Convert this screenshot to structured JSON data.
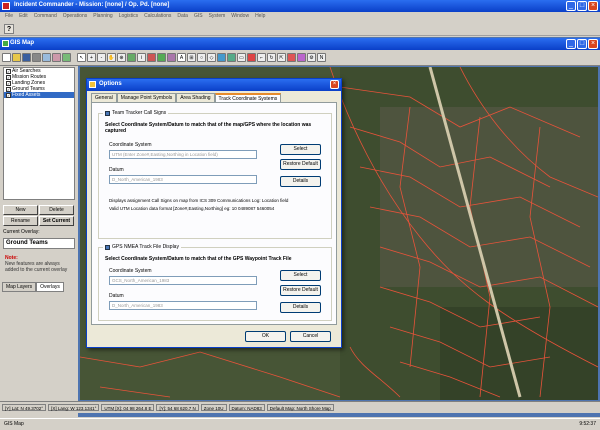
{
  "app": {
    "title": "Incident Commander - Mission: [none] / Op. Pd. [none]"
  },
  "menu": [
    "File",
    "Edit",
    "Command",
    "Operations",
    "Planning",
    "Logistics",
    "Calculations",
    "Data",
    "GIS",
    "System",
    "Window",
    "Help"
  ],
  "gis": {
    "title": "GIS Map"
  },
  "layers": [
    {
      "label": "Air Searches",
      "sel": false
    },
    {
      "label": "Mission Routes",
      "sel": false
    },
    {
      "label": "Landing Zones",
      "sel": false
    },
    {
      "label": "Ground Teams",
      "sel": false
    },
    {
      "label": "Fixed Assets",
      "sel": true
    }
  ],
  "left": {
    "new": "New",
    "delete": "Delete",
    "rename": "Rename",
    "set_current": "Set Current",
    "current_overlay_label": "Current Overlay:",
    "current_overlay": "Ground Teams",
    "note_title": "Note:",
    "note_text": "New features are always added to the current overlay",
    "tab_map_layers": "Map Layers",
    "tab_overlays": "Overlays"
  },
  "dialog": {
    "title": "Options",
    "tabs": [
      "General",
      "Manage Point Symbols",
      "Area Shading",
      "Track Coordinate Systems"
    ],
    "g1": {
      "label": "Team Tracker Call Signs",
      "instr": "Select Coordinate System/Datum to match that of the map/GPS where the location was captured",
      "cs_label": "Coordinate System",
      "cs_value": "UTM (Enter Zone#,Easting,Northing in Location field)",
      "datum_label": "Datum",
      "datum_value": "D_North_American_1983",
      "select": "Select",
      "restore": "Restore Default",
      "details": "Details",
      "help1": "Displays assignment Call Signs on map from ICS 309 Communications Log: Location field",
      "help2": "Valid UTM Location data format [Zone#,Easting,Northing] eg: 10 0489087 5460054"
    },
    "g2": {
      "label": "GPS NMEA Track File Display",
      "instr": "Select Coordinate System/Datum to match that of the GPS Waypoint Track File",
      "cs_label": "Coordinate System",
      "cs_value": "GCS_North_American_1983",
      "datum_label": "Datum",
      "datum_value": "D_North_American_1983",
      "select": "Select",
      "restore": "Restore Default",
      "details": "Details"
    },
    "ok": "OK",
    "cancel": "Cancel"
  },
  "status": {
    "lat": "[Y] Lat: N 49.3702°",
    "lng": "[X] Lang: W 123.1341°",
    "utmx": "UTM [X]: 04 98 264.8 E",
    "utmy": "[Y]: 54 68 620.7 N",
    "zone": "Zone 10U",
    "datum": "Datum: NAD83",
    "defmap": "Default Map: North Shore Map"
  },
  "taskbar": {
    "left": "GIS Map",
    "time": "9:52:37"
  },
  "colors": {
    "titlebar": "#0a3fc8",
    "map_roads": "#e8533a"
  }
}
